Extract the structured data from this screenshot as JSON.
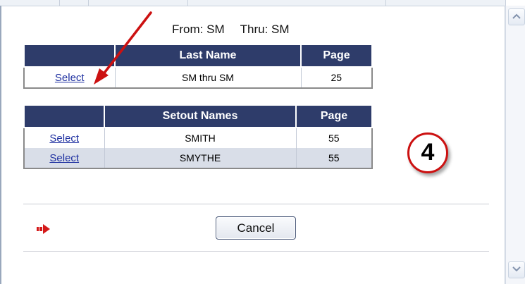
{
  "header": {
    "from_text": "From: SM",
    "thru_text": "Thru: SM"
  },
  "last_name_table": {
    "headers": [
      "",
      "Last Name",
      "Page"
    ],
    "rows": [
      {
        "action": "Select",
        "name": "SM thru SM",
        "page": "25"
      }
    ]
  },
  "setout_table": {
    "headers": [
      "",
      "Setout Names",
      "Page"
    ],
    "rows": [
      {
        "action": "Select",
        "name": "SMITH",
        "page": "55"
      },
      {
        "action": "Select",
        "name": "SMYTHE",
        "page": "55"
      }
    ]
  },
  "annotation": {
    "step_number": "4"
  },
  "actions": {
    "cancel_label": "Cancel"
  },
  "colors": {
    "header_bg": "#2e3c6a",
    "alt_row_bg": "#d9dee8",
    "annotation_red": "#cc1111",
    "link": "#1d2fa0"
  }
}
